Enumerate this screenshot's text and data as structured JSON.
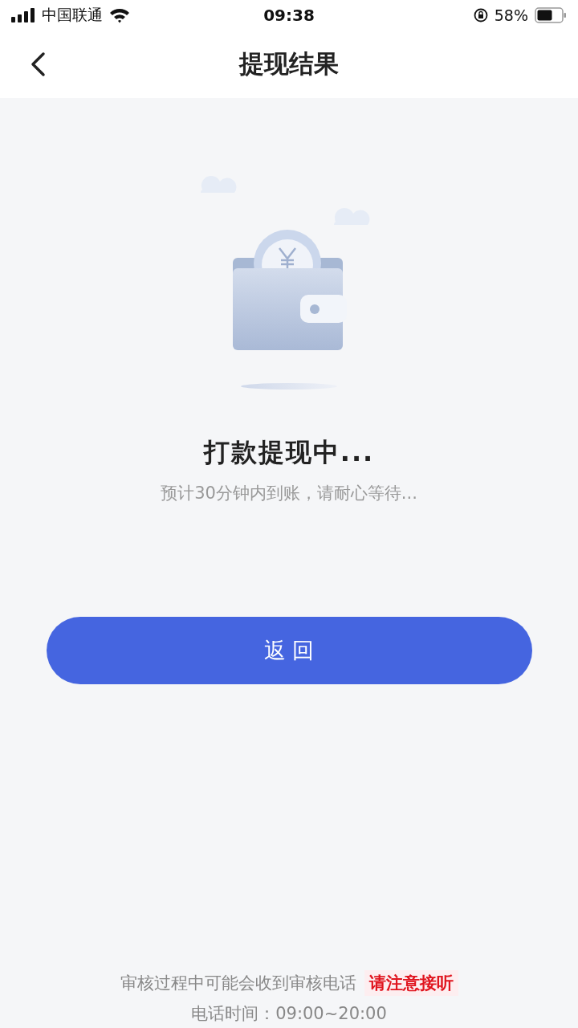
{
  "status_bar": {
    "carrier": "中国联通",
    "time": "09:38",
    "battery": "58%"
  },
  "nav": {
    "title": "提现结果"
  },
  "result": {
    "title": "打款提现中...",
    "subtitle": "预计30分钟内到账，请耐心等待..."
  },
  "buttons": [
    "返 回"
  ],
  "footer": {
    "notice": "审核过程中可能会收到审核电话",
    "highlight": "请注意接听",
    "hours": "电话时间：09:00~20:00"
  }
}
